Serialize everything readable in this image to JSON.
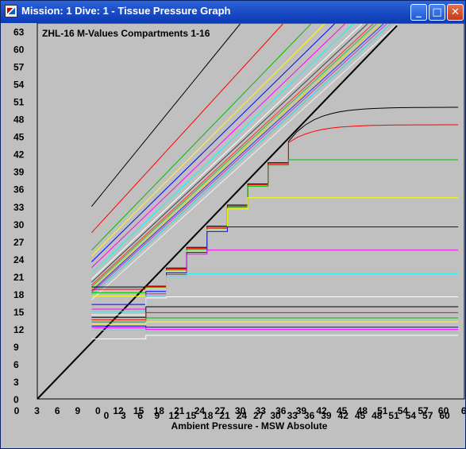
{
  "window": {
    "title": "Mission: 1 Dive: 1 - Tissue Pressure Graph",
    "buttons": {
      "minimize": "_",
      "maximize": "□",
      "close": "✕"
    }
  },
  "chart_data": {
    "type": "line",
    "title": "ZHL-16 M-Values Compartments 1-16",
    "xlabel": "Ambient Pressure - MSW Absolute",
    "ylabel": "",
    "ylim": [
      0,
      66
    ],
    "y_ticks": [
      "0",
      "3",
      "6",
      "9",
      "12",
      "15",
      "18",
      "21",
      "24",
      "27",
      "30",
      "33",
      "36",
      "39",
      "42",
      "45",
      "48",
      "51",
      "54",
      "57",
      "60",
      "63"
    ],
    "x_ticks": [
      "0",
      "3",
      "6",
      "9",
      "0",
      "12",
      "15",
      "18",
      "21",
      "24",
      "27",
      "30",
      "33",
      "36",
      "39",
      "42",
      "45",
      "48",
      "51",
      "54",
      "57",
      "60",
      "6"
    ],
    "x_ticks_row2": [
      "0",
      "3",
      "6",
      "9",
      "12",
      "15",
      "18",
      "21",
      "24",
      "27",
      "30",
      "33",
      "36",
      "39",
      "42",
      "45",
      "48",
      "51",
      "54",
      "57",
      "60",
      "6"
    ],
    "grid": false,
    "legend": "none",
    "ambient_line": {
      "color": "#000000",
      "from": [
        0,
        0
      ],
      "to": [
        53,
        64
      ]
    },
    "m_values": [
      {
        "color": "#000000",
        "start": [
          8,
          33.0
        ],
        "slope": 1.43
      },
      {
        "color": "#ff0000",
        "start": [
          8,
          28.5
        ],
        "slope": 1.27
      },
      {
        "color": "#00c000",
        "start": [
          8,
          25.5
        ],
        "slope": 1.2
      },
      {
        "color": "#ffff00",
        "start": [
          8,
          24.5
        ],
        "slope": 1.16
      },
      {
        "color": "#0000ff",
        "start": [
          8,
          23.5
        ],
        "slope": 1.14
      },
      {
        "color": "#ff00ff",
        "start": [
          8,
          22.5
        ],
        "slope": 1.12
      },
      {
        "color": "#00ffff",
        "start": [
          8,
          21.5
        ],
        "slope": 1.11
      },
      {
        "color": "#ffffff",
        "start": [
          8,
          20.5
        ],
        "slope": 1.1
      },
      {
        "color": "#404040",
        "start": [
          8,
          20.0
        ],
        "slope": 1.09
      },
      {
        "color": "#ff3030",
        "start": [
          8,
          19.5
        ],
        "slope": 1.08
      },
      {
        "color": "#30c030",
        "start": [
          8,
          19.2
        ],
        "slope": 1.075
      },
      {
        "color": "#e0e000",
        "start": [
          8,
          18.8
        ],
        "slope": 1.07
      },
      {
        "color": "#3030ff",
        "start": [
          8,
          18.5
        ],
        "slope": 1.065
      },
      {
        "color": "#c040c0",
        "start": [
          8,
          18.2
        ],
        "slope": 1.06
      },
      {
        "color": "#20e0e0",
        "start": [
          8,
          17.8
        ],
        "slope": 1.055
      },
      {
        "color": "#f0f0f0",
        "start": [
          8,
          17.0
        ],
        "slope": 1.05
      }
    ],
    "tissues": [
      {
        "color": "#000000",
        "final": 50.0
      },
      {
        "color": "#ff0000",
        "final": 47.0
      },
      {
        "color": "#00c000",
        "final": 41.0
      },
      {
        "color": "#ffff00",
        "final": 34.5
      },
      {
        "color": "#0000ff",
        "final": 29.5
      },
      {
        "color": "#ff00ff",
        "final": 25.5
      },
      {
        "color": "#00ffff",
        "final": 21.5
      },
      {
        "color": "#ffffff",
        "final": 17.5
      },
      {
        "color": "#000000",
        "final": 15.8
      },
      {
        "color": "#ff0000",
        "final": 14.8
      },
      {
        "color": "#00c000",
        "final": 13.9
      },
      {
        "color": "#ffff00",
        "final": 13.2
      },
      {
        "color": "#0000ff",
        "final": 12.3
      },
      {
        "color": "#ff00ff",
        "final": 11.9
      },
      {
        "color": "#00ffff",
        "final": 11.5
      },
      {
        "color": "#ffffff",
        "final": 10.9
      }
    ]
  }
}
